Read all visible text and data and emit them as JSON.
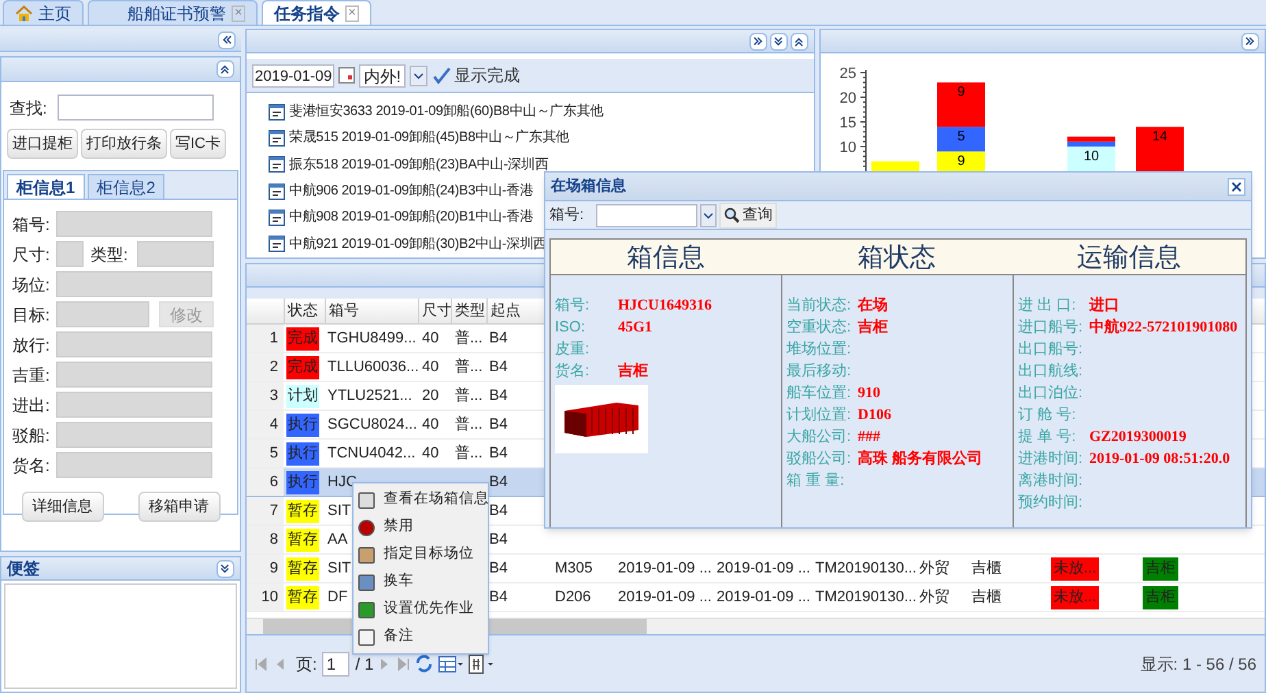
{
  "tabs": [
    {
      "label": "主页",
      "kind": "home",
      "selected": false
    },
    {
      "label": "船舶证书预警",
      "kind": "closable",
      "close": "×",
      "selected": false
    },
    {
      "label": "任务指令",
      "kind": "closable",
      "close": "×",
      "selected": true
    }
  ],
  "left_panel": {
    "search_label": "查找:",
    "buttons": [
      "进口提柜",
      "打印放行条",
      "写IC卡"
    ],
    "subtabs": [
      {
        "label": "柜信息1",
        "selected": true
      },
      {
        "label": "柜信息2",
        "selected": false
      }
    ],
    "fields": [
      {
        "label": "箱号:",
        "kind": "full"
      },
      {
        "label": "尺寸:",
        "kind": "pair",
        "second_label": "类型:"
      },
      {
        "label": "场位:",
        "kind": "full"
      },
      {
        "label": "目标:",
        "kind": "button",
        "button": "修改"
      },
      {
        "label": "放行:",
        "kind": "full"
      },
      {
        "label": "吉重:",
        "kind": "full"
      },
      {
        "label": "进出:",
        "kind": "full"
      },
      {
        "label": "驳船:",
        "kind": "full"
      },
      {
        "label": "货名:",
        "kind": "full"
      }
    ],
    "bottom_buttons": [
      "详细信息",
      "移箱申请"
    ]
  },
  "notes_panel": {
    "title": "便签"
  },
  "task_panel": {
    "date": "2019-01-09",
    "filter": "内外!",
    "show_done": "显示完成",
    "items": [
      "斐港恒安3633 2019-01-09卸船(60)B8中山～广东其他",
      "荣晟515 2019-01-09卸船(45)B8中山～广东其他",
      "振东518 2019-01-09卸船(23)BA中山-深圳西",
      "中航906 2019-01-09卸船(24)B3中山-香港",
      "中航908 2019-01-09卸船(20)B1中山-香港",
      "中航921 2019-01-09卸船(30)B2中山-深圳西"
    ]
  },
  "chart_panel": {
    "chart_data": {
      "type": "bar",
      "stacked": true,
      "categories": [
        null,
        null,
        null,
        null
      ],
      "ylim": [
        0,
        25
      ],
      "yticks": [
        10,
        15,
        20,
        25
      ],
      "series": [
        {
          "color": "#ffff00",
          "values": [
            7,
            9,
            null,
            null
          ],
          "value_labels": [
            null,
            "9",
            null,
            null
          ]
        },
        {
          "color": "#ccffff",
          "values": [
            null,
            null,
            10,
            null
          ],
          "value_labels": [
            null,
            null,
            "10",
            null
          ]
        },
        {
          "color": "#3366ff",
          "values": [
            null,
            5,
            1,
            null
          ],
          "value_labels": [
            null,
            "5",
            null,
            null
          ]
        },
        {
          "color": "#ff0000",
          "values": [
            null,
            9,
            1,
            14
          ],
          "value_labels": [
            null,
            "9",
            null,
            "14"
          ]
        }
      ]
    }
  },
  "grid": {
    "columns": [
      "状态",
      "箱号",
      "尺寸",
      "类型",
      "起点"
    ],
    "rows": [
      {
        "num": "1",
        "status": "完成",
        "color": "#ff0000",
        "box": "TGHU8499...",
        "size": "40",
        "type": "普...",
        "origin": "B4",
        "selected": false
      },
      {
        "num": "2",
        "status": "完成",
        "color": "#ff0000",
        "box": "TLLU60036...",
        "size": "40",
        "type": "普...",
        "origin": "B4",
        "selected": false
      },
      {
        "num": "3",
        "status": "计划",
        "color": "#ccffff",
        "box": "YTLU2521...",
        "size": "20",
        "type": "普...",
        "origin": "B4",
        "selected": false
      },
      {
        "num": "4",
        "status": "执行",
        "color": "#3366ff",
        "box": "SGCU8024...",
        "size": "40",
        "type": "普...",
        "origin": "B4",
        "selected": false
      },
      {
        "num": "5",
        "status": "执行",
        "color": "#3366ff",
        "box": "TCNU4042...",
        "size": "40",
        "type": "普...",
        "origin": "B4",
        "selected": false
      },
      {
        "num": "6",
        "status": "执行",
        "color": "#3366ff",
        "box": "HJC",
        "origin": "B4",
        "selected": true
      },
      {
        "num": "7",
        "status": "暂存",
        "color": "#ffff00",
        "box": "SIT",
        "origin": "B4",
        "selected": false
      },
      {
        "num": "8",
        "status": "暂存",
        "color": "#ffff00",
        "box": "AA",
        "origin": "B4",
        "selected": false
      },
      {
        "num": "9",
        "status": "暂存",
        "color": "#ffff00",
        "box": "SIT",
        "origin": "B4",
        "selected": false,
        "cells": [
          "M305",
          "2019-01-09 ...",
          "2019-01-09 ...",
          "TM20190130...",
          "外贸",
          "吉櫃"
        ],
        "release": "未放...",
        "load": "吉柜"
      },
      {
        "num": "10",
        "status": "暂存",
        "color": "#ffff00",
        "box": "DF",
        "origin": "B4",
        "selected": false,
        "cells": [
          "D206",
          "2019-01-09 ...",
          "2019-01-09 ...",
          "TM20190130...",
          "外贸",
          "吉櫃"
        ],
        "release": "未放...",
        "load": "吉柜"
      }
    ],
    "pager": {
      "page_label": "页:",
      "page": "1",
      "total": "/ 1",
      "summary": "显示: 1 - 56 / 56"
    }
  },
  "context_menu": [
    "查看在场箱信息",
    "禁用",
    "指定目标场位",
    "换车",
    "设置优先作业",
    "备注"
  ],
  "popup": {
    "title": "在场箱信息",
    "search_label": "箱号:",
    "search_button": "查询",
    "sections": [
      {
        "title": "箱信息",
        "rows": [
          {
            "label": "箱号:",
            "value": "HJCU1649316"
          },
          {
            "label": "ISO:",
            "value": "45G1"
          },
          {
            "label": "皮重:"
          },
          {
            "label": "货名:",
            "value": "吉柜"
          }
        ]
      },
      {
        "title": "箱状态",
        "rows": [
          {
            "label": "当前状态:",
            "value": "在场"
          },
          {
            "label": "空重状态:",
            "value": "吉柜"
          },
          {
            "label": "堆场位置:"
          },
          {
            "label": "最后移动:"
          },
          {
            "label": "船车位置:",
            "value": "910"
          },
          {
            "label": "计划位置:",
            "value": "D106"
          },
          {
            "label": "大船公司:",
            "value": "###"
          },
          {
            "label": "驳船公司:",
            "value": "高珠 船务有限公司"
          },
          {
            "label": "箱 重 量:"
          }
        ]
      },
      {
        "title": "运输信息",
        "rows": [
          {
            "label": "进 出 口:",
            "value": "进口"
          },
          {
            "label": "进口船号:",
            "value": "中航922-572101901080"
          },
          {
            "label": "出口船号:"
          },
          {
            "label": "出口航线:"
          },
          {
            "label": "出口泊位:"
          },
          {
            "label": "订 舱 号:"
          },
          {
            "label": "提 单 号:",
            "value": "GZ2019300019"
          },
          {
            "label": "进港时间:",
            "value": "2019-01-09 08:51:20.0"
          },
          {
            "label": "离港时间:"
          },
          {
            "label": "预约时间:"
          }
        ]
      }
    ]
  }
}
